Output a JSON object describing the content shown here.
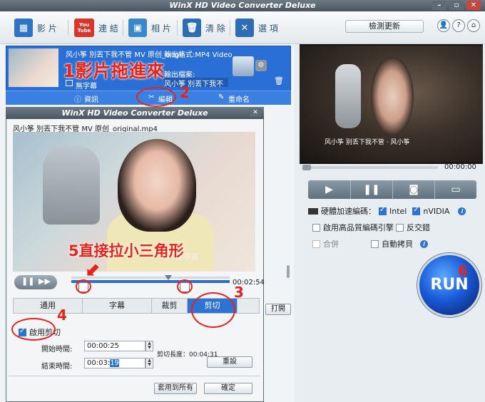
{
  "app": {
    "title": "WinX HD Video Converter Deluxe"
  },
  "toolbar": {
    "video_label": "影 片",
    "youtube_icon_text": "You Tube",
    "youtube_label": "連 結",
    "photo_label": "相 片",
    "clear_label": "清 除",
    "options_label": "選 項",
    "check_update_label": "檢測更新"
  },
  "task": {
    "filename_short": "风小筝 別丟下我不管 MV 原创_origir",
    "format_label": "輸出格式:MP4 Video",
    "subtitle_label": "無字幕",
    "output_label": "輸出檔案:",
    "output_value": "风小筝 別丟下我不管 MV",
    "info_label": "資訊",
    "edit_label": "編輯",
    "rename_label": "重命名"
  },
  "dialog": {
    "title": "WinX HD Video Converter Deluxe",
    "filename": "风小筝 別丟下我不管 MV 原创_original.mp4",
    "video_caption": "我不管",
    "time_display": "00:02:54",
    "tabs": [
      "通用",
      "字幕",
      "裁剪",
      "剪切"
    ],
    "enable_trim_label": "啟用剪切",
    "start_label": "開始時間:",
    "start_value": "00:00:25",
    "end_label": "結束時間:",
    "end_value_prefix": "00:03:",
    "end_value_selected": "19",
    "trim_length": "剪切長度：00:04:31",
    "reset_label": "重設",
    "apply_all_label": "套用到所有",
    "ok_label": "確定",
    "open_label": "打開"
  },
  "preview": {
    "time": "00:00:00",
    "caption": "风小筝 别丢下我不管 · 风小筝"
  },
  "options": {
    "hw_label": "硬體加速編碼：",
    "intel_label": "Intel",
    "nvidia_label": "nVIDIA",
    "hq_label": "啟用高品質編碼引擎",
    "deinterlace_label": "反交錯",
    "merge_label": "合併",
    "autocopy_label": "自動拷貝",
    "run_label": "RUN"
  },
  "annotations": {
    "a1": "1影片拖進來",
    "a2": "2",
    "a3": "3",
    "a4": "4",
    "a5": "5直接拉小三角形",
    "a6": "6"
  },
  "colors": {
    "accent": "#2c73d3",
    "annotation": "#e8231a",
    "titlebar": "#4a5560"
  }
}
